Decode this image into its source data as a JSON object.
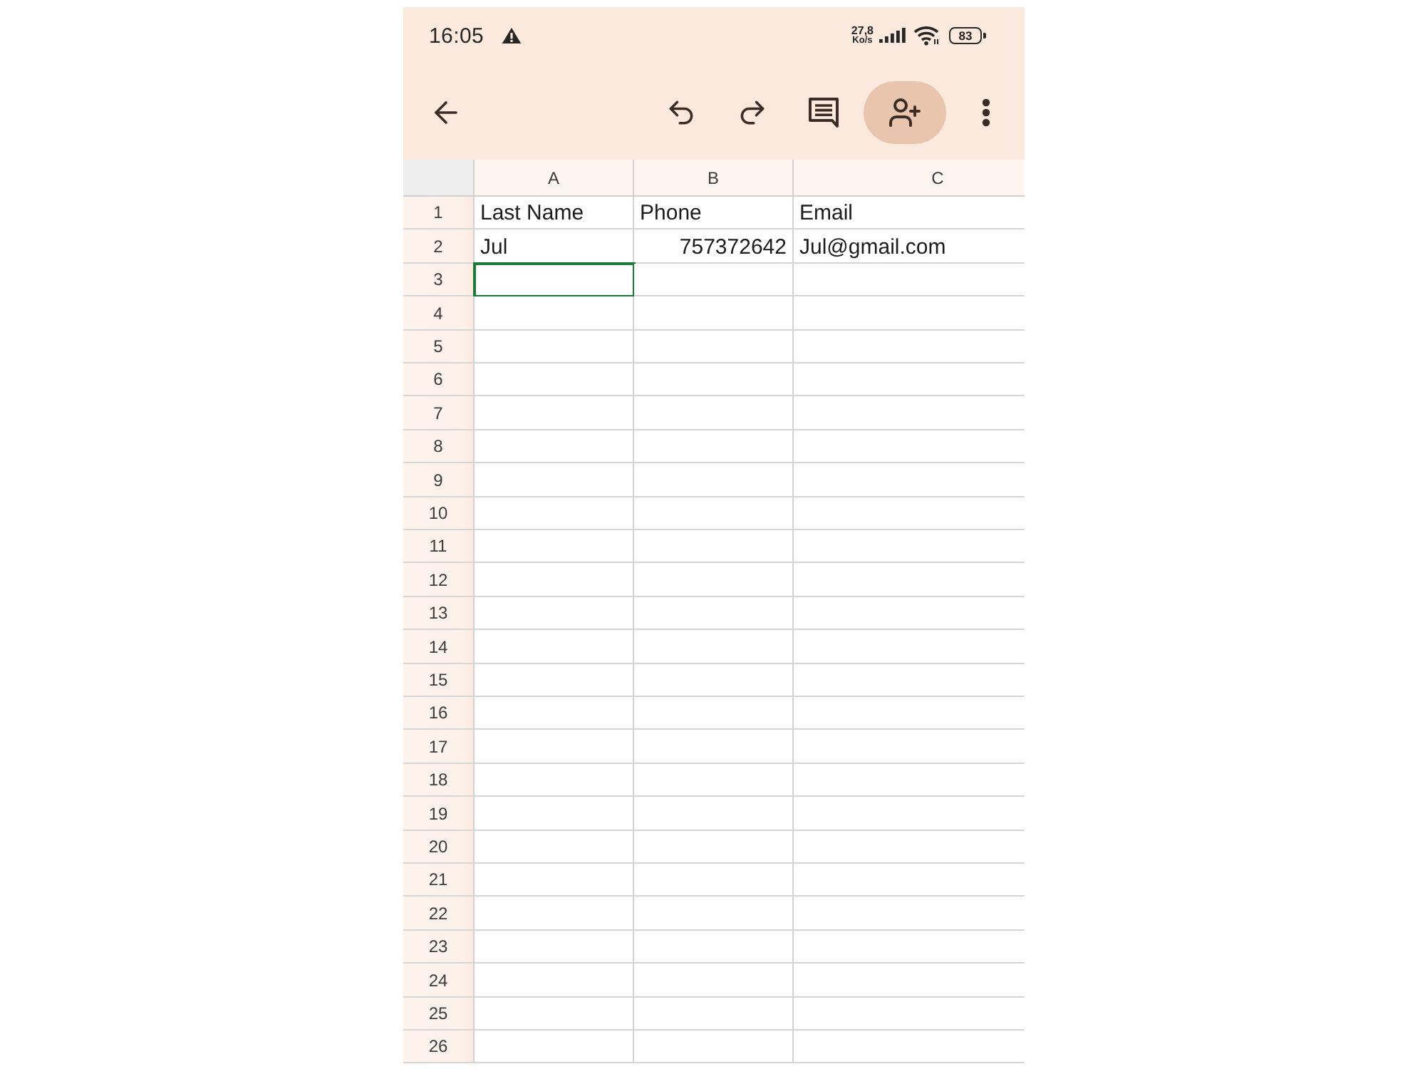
{
  "status_bar": {
    "time": "16:05",
    "network_speed": "27,8",
    "network_speed_unit": "Ko/s",
    "battery": "83"
  },
  "sheet": {
    "columns": [
      "A",
      "B",
      "C"
    ],
    "rows": [
      {
        "label": "1",
        "cells": [
          {
            "text": "Last Name",
            "kind": "text",
            "selected": false
          },
          {
            "text": "Phone",
            "kind": "text",
            "selected": false
          },
          {
            "text": "Email",
            "kind": "text",
            "selected": false
          }
        ]
      },
      {
        "label": "2",
        "cells": [
          {
            "text": "Jul",
            "kind": "text",
            "selected": false
          },
          {
            "text": "757372642",
            "kind": "number",
            "selected": false
          },
          {
            "text": "Jul@gmail.com",
            "kind": "text",
            "selected": false
          }
        ]
      },
      {
        "label": "3",
        "cells": [
          {
            "selected": true
          },
          {
            "selected": false
          },
          {
            "selected": false
          }
        ]
      },
      {
        "label": "4",
        "cells": [
          {
            "selected": false
          },
          {
            "selected": false
          },
          {
            "selected": false
          }
        ]
      },
      {
        "label": "5",
        "cells": [
          {
            "selected": false
          },
          {
            "selected": false
          },
          {
            "selected": false
          }
        ]
      },
      {
        "label": "6",
        "cells": [
          {
            "selected": false
          },
          {
            "selected": false
          },
          {
            "selected": false
          }
        ]
      },
      {
        "label": "7",
        "cells": [
          {
            "selected": false
          },
          {
            "selected": false
          },
          {
            "selected": false
          }
        ]
      },
      {
        "label": "8",
        "cells": [
          {
            "selected": false
          },
          {
            "selected": false
          },
          {
            "selected": false
          }
        ]
      },
      {
        "label": "9",
        "cells": [
          {
            "selected": false
          },
          {
            "selected": false
          },
          {
            "selected": false
          }
        ]
      },
      {
        "label": "10",
        "cells": [
          {
            "selected": false
          },
          {
            "selected": false
          },
          {
            "selected": false
          }
        ]
      },
      {
        "label": "11",
        "cells": [
          {
            "selected": false
          },
          {
            "selected": false
          },
          {
            "selected": false
          }
        ]
      },
      {
        "label": "12",
        "cells": [
          {
            "selected": false
          },
          {
            "selected": false
          },
          {
            "selected": false
          }
        ]
      },
      {
        "label": "13",
        "cells": [
          {
            "selected": false
          },
          {
            "selected": false
          },
          {
            "selected": false
          }
        ]
      },
      {
        "label": "14",
        "cells": [
          {
            "selected": false
          },
          {
            "selected": false
          },
          {
            "selected": false
          }
        ]
      },
      {
        "label": "15",
        "cells": [
          {
            "selected": false
          },
          {
            "selected": false
          },
          {
            "selected": false
          }
        ]
      },
      {
        "label": "16",
        "cells": [
          {
            "selected": false
          },
          {
            "selected": false
          },
          {
            "selected": false
          }
        ]
      },
      {
        "label": "17",
        "cells": [
          {
            "selected": false
          },
          {
            "selected": false
          },
          {
            "selected": false
          }
        ]
      },
      {
        "label": "18",
        "cells": [
          {
            "selected": false
          },
          {
            "selected": false
          },
          {
            "selected": false
          }
        ]
      },
      {
        "label": "19",
        "cells": [
          {
            "selected": false
          },
          {
            "selected": false
          },
          {
            "selected": false
          }
        ]
      },
      {
        "label": "20",
        "cells": [
          {
            "selected": false
          },
          {
            "selected": false
          },
          {
            "selected": false
          }
        ]
      },
      {
        "label": "21",
        "cells": [
          {
            "selected": false
          },
          {
            "selected": false
          },
          {
            "selected": false
          }
        ]
      },
      {
        "label": "22",
        "cells": [
          {
            "selected": false
          },
          {
            "selected": false
          },
          {
            "selected": false
          }
        ]
      },
      {
        "label": "23",
        "cells": [
          {
            "selected": false
          },
          {
            "selected": false
          },
          {
            "selected": false
          }
        ]
      },
      {
        "label": "24",
        "cells": [
          {
            "selected": false
          },
          {
            "selected": false
          },
          {
            "selected": false
          }
        ]
      },
      {
        "label": "25",
        "cells": [
          {
            "selected": false
          },
          {
            "selected": false
          },
          {
            "selected": false
          }
        ]
      },
      {
        "label": "26",
        "cells": [
          {
            "selected": false
          },
          {
            "selected": false
          },
          {
            "selected": false
          }
        ]
      }
    ]
  }
}
